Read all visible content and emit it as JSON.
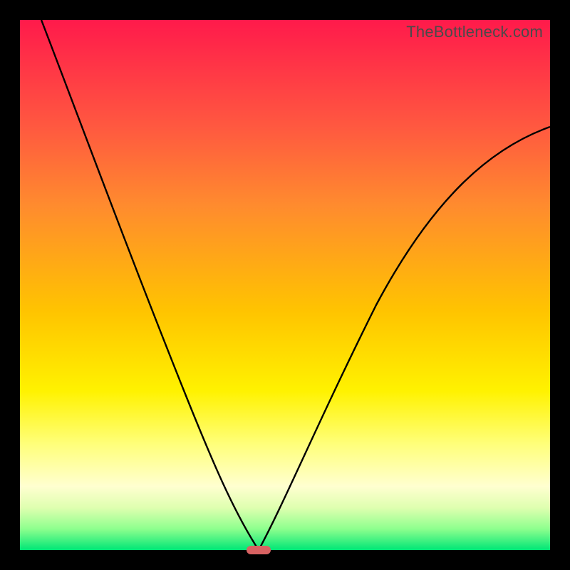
{
  "watermark": "TheBottleneck.com",
  "colors": {
    "frame": "#000000",
    "curve_stroke": "#000000",
    "marker_fill": "#d86262",
    "gradient_top": "#ff1a4b",
    "gradient_bottom": "#00e676"
  },
  "chart_data": {
    "type": "line",
    "title": "",
    "xlabel": "",
    "ylabel": "",
    "xlim": [
      0,
      100
    ],
    "ylim": [
      0,
      100
    ],
    "grid": false,
    "legend": false,
    "series": [
      {
        "name": "left-branch",
        "x": [
          4,
          10,
          16,
          22,
          28,
          33,
          37,
          40,
          43,
          45
        ],
        "y": [
          100,
          83,
          67,
          52,
          38,
          26,
          16,
          8,
          3,
          0
        ]
      },
      {
        "name": "right-branch",
        "x": [
          45,
          48,
          52,
          57,
          63,
          70,
          78,
          87,
          100
        ],
        "y": [
          0,
          3,
          8,
          16,
          26,
          38,
          51,
          64,
          80
        ]
      }
    ],
    "minimum_marker": {
      "x": 45,
      "y": 0
    },
    "notes": "V-shaped bottleneck curve over rainbow heat gradient; minimum ~x=45 at y=0."
  }
}
